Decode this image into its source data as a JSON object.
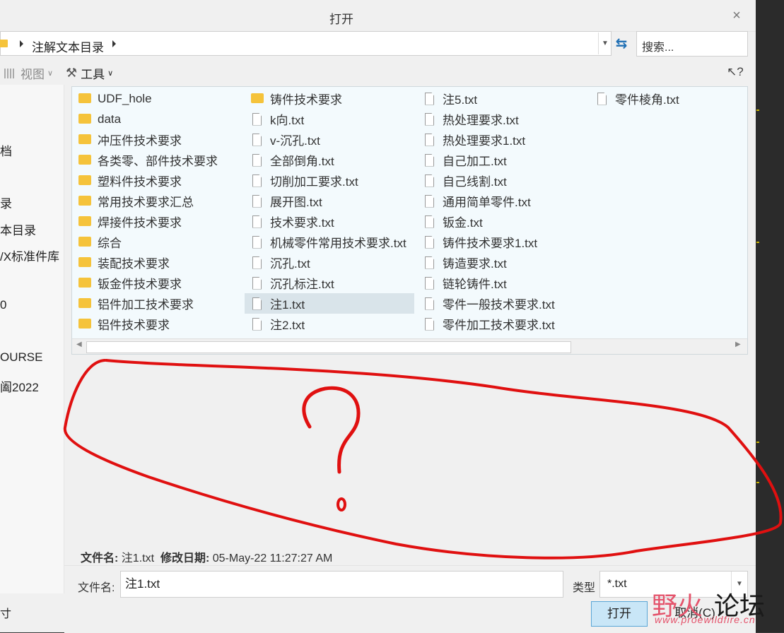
{
  "dialog": {
    "title": "打开"
  },
  "address": {
    "breadcrumb": "注解文本目录"
  },
  "search": {
    "placeholder": "搜索..."
  },
  "toolbar": {
    "view_label": "视图",
    "tools_label": "工具",
    "help": "?"
  },
  "sidebar": {
    "items": [
      "档",
      "录",
      "本目录",
      "/X标准件库",
      "0",
      "OURSE",
      "阖2022"
    ],
    "bottom": "寸"
  },
  "files": {
    "col1": [
      "UDF_hole",
      "data",
      "冲压件技术要求",
      "各类零、部件技术要求",
      "塑料件技术要求",
      "常用技术要求汇总",
      "焊接件技术要求",
      "综合",
      "装配技术要求",
      "钣金件技术要求",
      "铝件加工技术要求",
      "铝件技术要求"
    ],
    "col2": [
      "铸件技术要求",
      "k向.txt",
      "v-沉孔.txt",
      "全部倒角.txt",
      "切削加工要求.txt",
      "展开图.txt",
      "技术要求.txt",
      "机械零件常用技术要求.txt",
      "沉孔.txt",
      "沉孔标注.txt",
      "注1.txt",
      "注2.txt"
    ],
    "col3": [
      "注5.txt",
      "热处理要求.txt",
      "热处理要求1.txt",
      "自己加工.txt",
      "自己线割.txt",
      "通用简单零件.txt",
      "钣金.txt",
      "铸件技术要求1.txt",
      "铸造要求.txt",
      "链轮铸件.txt",
      "零件一般技术要求.txt",
      "零件加工技术要求.txt"
    ],
    "col4": [
      "零件棱角.txt"
    ]
  },
  "info": {
    "filename_label": "文件名:",
    "filename": "注1.txt",
    "modified_label": "修改日期:",
    "modified": "05-May-22 11:27:27 AM"
  },
  "bottom": {
    "filename_label": "文件名:",
    "filename_value": "注1.txt",
    "type_label": "类型",
    "type_value": "*.txt",
    "open": "打开",
    "cancel": "取消(C)"
  },
  "watermark": {
    "left": "野火",
    "right": "论坛",
    "url": "www.proewildfire.cn"
  },
  "annotation": {
    "mark": "?"
  },
  "colors": {
    "annotation": "#e01010",
    "selected": "#d9e4ea",
    "accent": "#5aa6d6"
  }
}
